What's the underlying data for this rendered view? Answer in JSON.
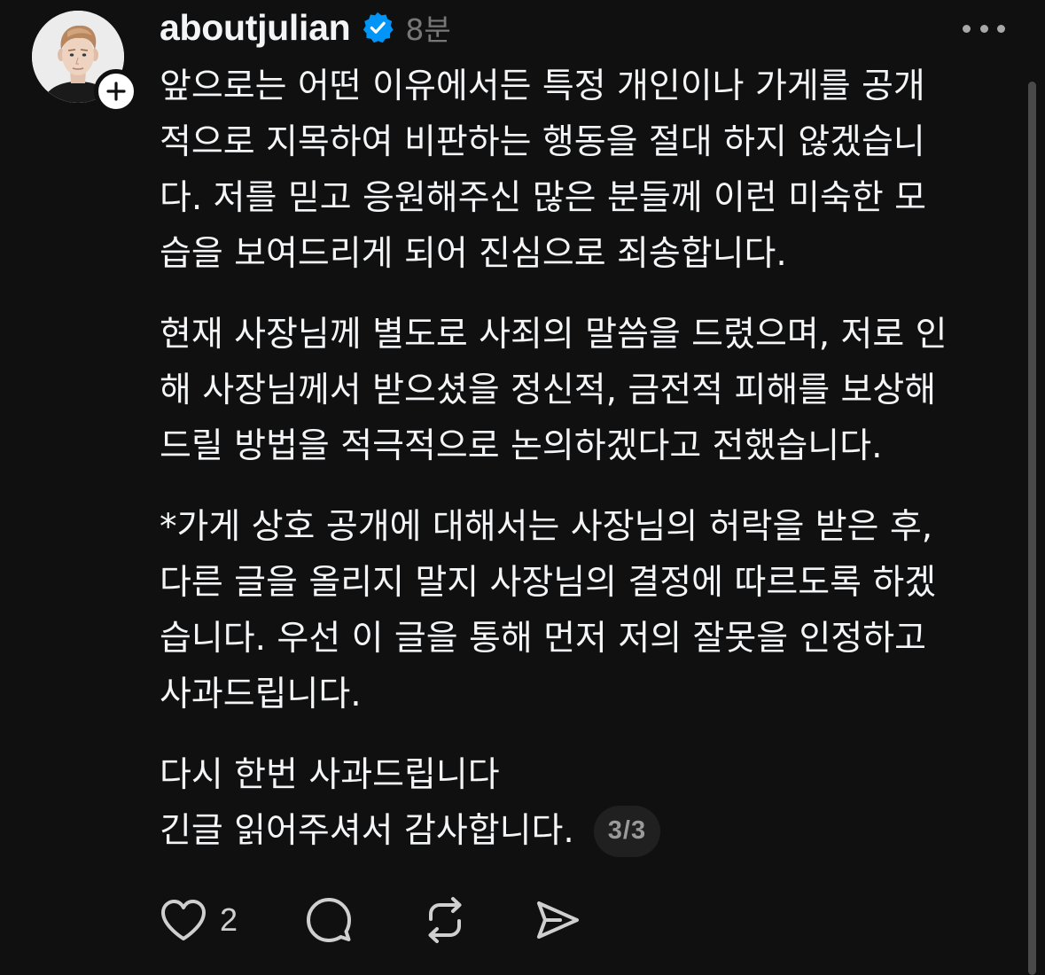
{
  "post": {
    "username": "aboutjulian",
    "timestamp": "8분",
    "paragraphs": [
      {
        "lines": [
          "앞으로는 어떤 이유에서든 특정 개인이나 가게를 공개",
          "적으로 지목하여 비판하는 행동을 절대 하지 않겠습니",
          "다. 저를 믿고 응원해주신 많은 분들께 이런 미숙한 모",
          "습을 보여드리게 되어 진심으로 죄송합니다."
        ]
      },
      {
        "lines": [
          "현재 사장님께 별도로 사죄의 말씀을 드렸으며, 저로 인",
          "해 사장님께서 받으셨을 정신적, 금전적 피해를 보상해",
          "드릴 방법을 적극적으로 논의하겠다고 전했습니다."
        ]
      },
      {
        "lines": [
          "*가게 상호 공개에 대해서는 사장님의 허락을 받은 후,",
          "다른 글을 올리지 말지 사장님의 결정에 따르도록 하겠",
          "습니다. 우선 이 글을 통해 먼저 저의 잘못을 인정하고",
          "사과드립니다."
        ]
      },
      {
        "lines": [
          "다시 한번 사과드립니다"
        ]
      }
    ],
    "closing_line": "긴글 읽어주셔서 감사합니다.",
    "page_indicator": "3/3"
  },
  "actions": {
    "like_count": "2",
    "icons": [
      "heart-icon",
      "reply-icon",
      "repost-icon",
      "share-icon"
    ]
  },
  "colors": {
    "background": "#101010",
    "text": "#f3f5f7",
    "secondary": "#777777",
    "verified": "#0095f6"
  }
}
